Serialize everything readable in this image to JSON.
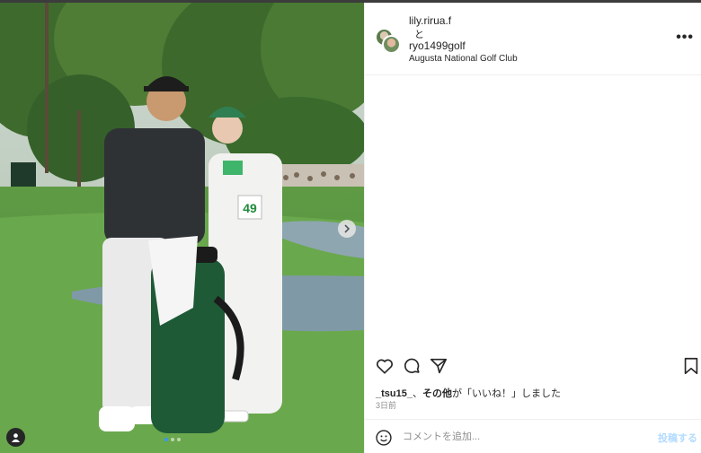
{
  "post": {
    "user1": "lily.rirua.f",
    "and_text": "と",
    "user2": "ryo1499golf",
    "location": "Augusta National Golf Club",
    "more_label": "•••",
    "bib_number": "49",
    "likes": {
      "first_user": "_tsu15_",
      "separator": "、",
      "others": "その他",
      "suffix": "が「いいね！」しました"
    },
    "time": "3日前"
  },
  "comment": {
    "placeholder": "コメントを追加...",
    "post_label": "投稿する"
  },
  "icons": {
    "like": "heart-icon",
    "comment": "comment-icon",
    "share": "share-icon",
    "save": "bookmark-icon",
    "emoji": "emoji-icon",
    "next": "chevron-right-icon",
    "tags": "user-tag-icon"
  },
  "colors": {
    "post_button": "#b3dbff",
    "active_dot": "#3897f0"
  },
  "carousel": {
    "total": 3,
    "active": 1
  }
}
